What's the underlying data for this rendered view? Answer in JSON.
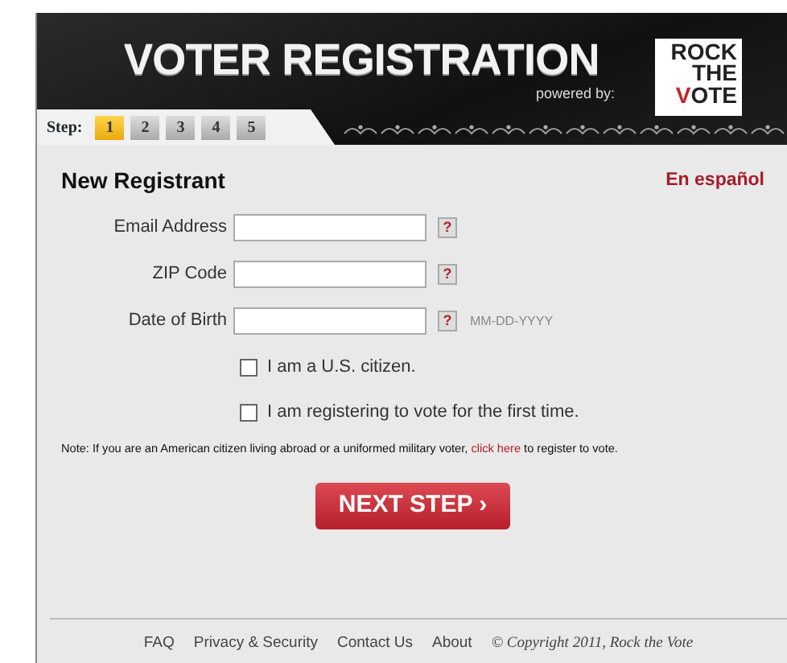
{
  "header": {
    "title": "VOTER REGISTRATION",
    "powered_by": "powered by:",
    "logo": [
      "ROCK",
      "THE",
      "VOTE"
    ]
  },
  "steps": {
    "label": "Step:",
    "items": [
      {
        "label": "1",
        "selected": true
      },
      {
        "label": "2",
        "selected": false
      },
      {
        "label": "3",
        "selected": false
      },
      {
        "label": "4",
        "selected": false
      },
      {
        "label": "5",
        "selected": false
      }
    ]
  },
  "form": {
    "title": "New Registrant",
    "language_link": "En español",
    "fields": [
      {
        "label": "Email Address",
        "help": "?"
      },
      {
        "label": "ZIP Code",
        "help": "?"
      },
      {
        "label": "Date of Birth",
        "help": "?",
        "hint": "MM-DD-YYYY"
      }
    ],
    "checkboxes": [
      {
        "label": "I am a U.S. citizen.",
        "checked": false
      },
      {
        "label": "I am registering to vote for the first time.",
        "checked": false
      }
    ],
    "note": {
      "text": "Note: If you are an American citizen living abroad or a uniformed military voter,",
      "link": "click here",
      "after": "to register to vote."
    },
    "next_button": {
      "label": "NEXT STEP",
      "arrow": "›"
    }
  },
  "footer": {
    "links": [
      "FAQ",
      "Privacy & Security",
      "Contact Us",
      "About"
    ],
    "copyright": "© Copyright 2011, Rock the Vote"
  }
}
